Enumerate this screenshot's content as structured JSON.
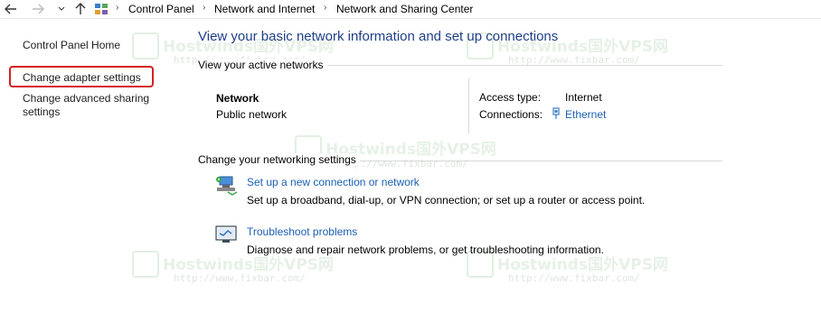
{
  "address_bar": {
    "breadcrumbs": [
      "Control Panel",
      "Network and Internet",
      "Network and Sharing Center"
    ]
  },
  "left_pane": {
    "home": "Control Panel Home",
    "adapter": "Change adapter settings",
    "sharing_line1": "Change advanced sharing",
    "sharing_line2": "settings"
  },
  "main": {
    "title": "View your basic network information and set up connections",
    "active_header": "View your active networks",
    "network_name": "Network",
    "network_type": "Public network",
    "access_label": "Access type:",
    "access_value": "Internet",
    "connections_label": "Connections:",
    "connections_value": "Ethernet",
    "settings_header": "Change your networking settings",
    "setup_link": "Set up a new connection or network",
    "setup_desc": "Set up a broadband, dial-up, or VPN connection; or set up a router or access point.",
    "trouble_link": "Troubleshoot problems",
    "trouble_desc": "Diagnose and repair network problems, or get troubleshooting information."
  },
  "watermark": {
    "text": "Hostwinds国外VPS网",
    "url": "http://www.fixbar.com/"
  },
  "colors": {
    "title": "#1e3f87",
    "link": "#1a5fb4",
    "highlight": "#d42020"
  },
  "icons": [
    "back-arrow-icon",
    "forward-arrow-icon",
    "chevron-down-icon",
    "up-arrow-icon",
    "control-panel-icon",
    "ethernet-icon",
    "network-setup-icon",
    "troubleshoot-icon"
  ]
}
